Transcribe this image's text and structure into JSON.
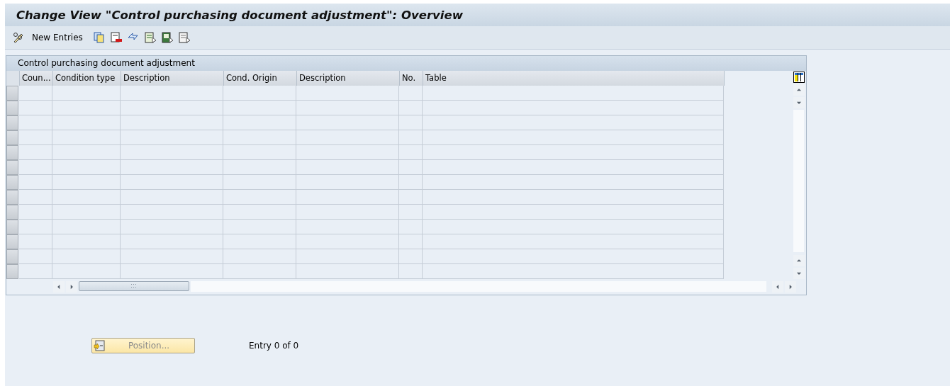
{
  "window": {
    "title": "Change View \"Control purchasing document adjustment\": Overview"
  },
  "toolbar": {
    "new_entries": "New Entries"
  },
  "table": {
    "title": "Control purchasing document adjustment",
    "columns": [
      "Coun...",
      "Condition type",
      "Description",
      "Cond. Origin",
      "Description",
      "No.",
      "Table"
    ],
    "rows": [
      {
        "selected": false
      },
      {
        "selected": false
      },
      {
        "selected": false
      },
      {
        "selected": false
      },
      {
        "selected": false
      },
      {
        "selected": false
      },
      {
        "selected": false
      },
      {
        "selected": false
      },
      {
        "selected": false
      },
      {
        "selected": false
      },
      {
        "selected": false
      },
      {
        "selected": false
      },
      {
        "selected": false
      }
    ]
  },
  "position_button": "Position...",
  "entry_status": "Entry 0 of 0"
}
